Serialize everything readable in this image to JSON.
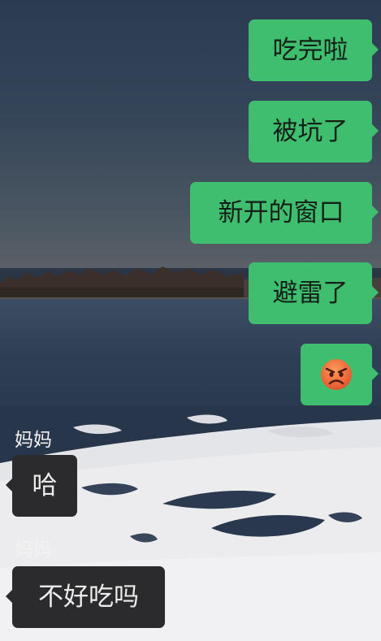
{
  "chat": {
    "messages": [
      {
        "direction": "out",
        "type": "text",
        "text": "吃完啦"
      },
      {
        "direction": "out",
        "type": "text",
        "text": "被坑了"
      },
      {
        "direction": "out",
        "type": "text",
        "text": "新开的窗口"
      },
      {
        "direction": "out",
        "type": "text",
        "text": "避雷了"
      },
      {
        "direction": "out",
        "type": "emoji",
        "emoji": "angry-face-icon"
      },
      {
        "direction": "in",
        "type": "text",
        "sender": "妈妈",
        "text": "哈"
      },
      {
        "direction": "in",
        "type": "text",
        "sender": "妈妈",
        "text": "不好吃吗"
      }
    ]
  },
  "colors": {
    "outgoing_bubble": "#3fbe6f",
    "outgoing_text": "#142017",
    "incoming_bubble": "#2b2b2d",
    "incoming_text": "#ececec",
    "sender_name": "#f2f2f2",
    "emoji_face": "#ee6a2c"
  },
  "wallpaper": {
    "scene": "frozen lake with bare trees and snow"
  }
}
